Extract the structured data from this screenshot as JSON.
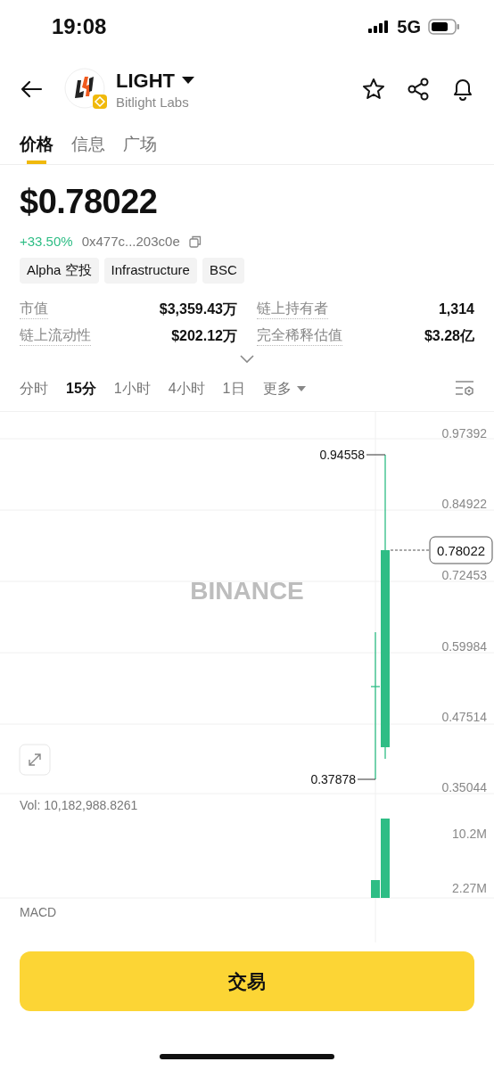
{
  "status_bar": {
    "time": "19:08",
    "network": "5G"
  },
  "header": {
    "symbol": "LIGHT",
    "project": "Bitlight Labs"
  },
  "tabs": [
    {
      "label": "价格",
      "selected": true
    },
    {
      "label": "信息",
      "selected": false
    },
    {
      "label": "广场",
      "selected": false
    }
  ],
  "price": "$0.78022",
  "change": "+33.50%",
  "contract": "0x477c...203c0e",
  "tags": [
    "Alpha 空投",
    "Infrastructure",
    "BSC"
  ],
  "stats": [
    {
      "label": "市值",
      "value": "$3,359.43万"
    },
    {
      "label": "链上持有者",
      "value": "1,314"
    },
    {
      "label": "链上流动性",
      "value": "$202.12万"
    },
    {
      "label": "完全稀释估值",
      "value": "$3.28亿"
    }
  ],
  "intervals": [
    {
      "label": "分时",
      "selected": false
    },
    {
      "label": "15分",
      "selected": true
    },
    {
      "label": "1小时",
      "selected": false
    },
    {
      "label": "4小时",
      "selected": false
    },
    {
      "label": "1日",
      "selected": false
    }
  ],
  "more": "更多",
  "chart": {
    "y_labels": [
      "0.97392",
      "0.84922",
      "0.72453",
      "0.59984",
      "0.47514",
      "0.35044"
    ],
    "high_label": "0.94558",
    "low_label": "0.37878",
    "last_price": "0.78022",
    "watermark": "BINANCE",
    "volume_label": "Vol: 10,182,988.8261",
    "volume_ticks": [
      "10.2M",
      "2.27M"
    ],
    "indicator_label": "MACD"
  },
  "trade_button": "交易"
}
